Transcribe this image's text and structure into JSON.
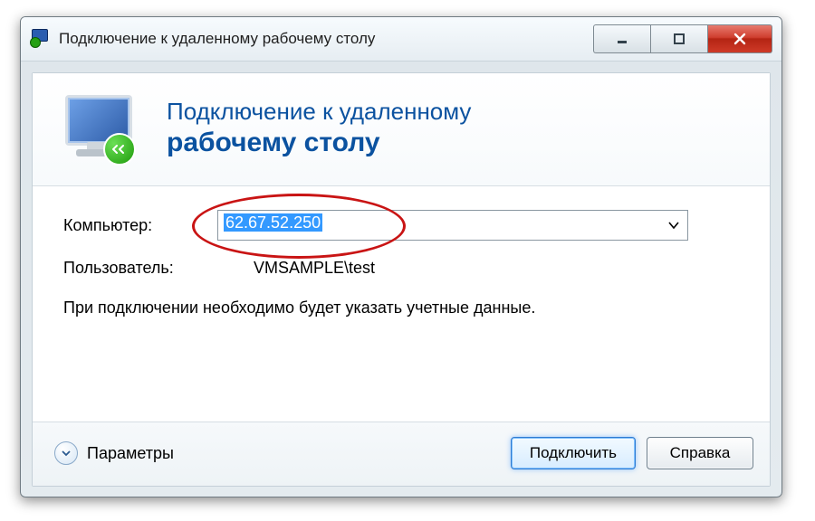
{
  "window": {
    "title": "Подключение к удаленному рабочему столу"
  },
  "header": {
    "line1": "Подключение к удаленному",
    "line2": "рабочему столу"
  },
  "form": {
    "computer_label": "Компьютер:",
    "computer_value": "62.67.52.250",
    "user_label": "Пользователь:",
    "user_value": "VMSAMPLE\\test",
    "hint": "При подключении необходимо будет указать учетные данные."
  },
  "footer": {
    "options": "Параметры",
    "connect": "Подключить",
    "help": "Справка"
  }
}
